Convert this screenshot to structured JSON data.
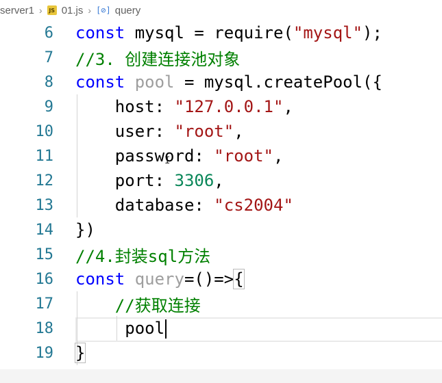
{
  "breadcrumb": {
    "folder": "server1",
    "file": "01.js",
    "file_icon": "js-file-icon",
    "symbol": "query",
    "symbol_icon": "variable-symbol-icon"
  },
  "editor": {
    "lines": [
      {
        "n": "6",
        "tokens": [
          [
            "kw",
            "const"
          ],
          [
            "code",
            " mysql = require("
          ],
          [
            "str",
            "\"mysql\""
          ],
          [
            "code",
            ");"
          ]
        ]
      },
      {
        "n": "7",
        "tokens": [
          [
            "cm",
            "//3. 创建连接池对象"
          ]
        ]
      },
      {
        "n": "8",
        "tokens": [
          [
            "kw",
            "const"
          ],
          [
            "code",
            " "
          ],
          [
            "faded",
            "pool"
          ],
          [
            "code",
            " = mysql.createPool({"
          ]
        ]
      },
      {
        "n": "9",
        "tokens": [
          [
            "code",
            "    host: "
          ],
          [
            "str",
            "\"127.0.0.1\""
          ],
          [
            "code",
            ","
          ]
        ]
      },
      {
        "n": "10",
        "tokens": [
          [
            "code",
            "    user: "
          ],
          [
            "str",
            "\"root\""
          ],
          [
            "code",
            ","
          ]
        ]
      },
      {
        "n": "11",
        "tokens": [
          [
            "code",
            "    password: "
          ],
          [
            "str",
            "\"root\""
          ],
          [
            "code",
            ","
          ]
        ]
      },
      {
        "n": "12",
        "tokens": [
          [
            "code",
            "    port: "
          ],
          [
            "num",
            "3306"
          ],
          [
            "code",
            ","
          ]
        ]
      },
      {
        "n": "13",
        "tokens": [
          [
            "code",
            "    database: "
          ],
          [
            "str",
            "\"cs2004\""
          ]
        ]
      },
      {
        "n": "14",
        "tokens": [
          [
            "code",
            "})"
          ]
        ]
      },
      {
        "n": "15",
        "tokens": [
          [
            "cm",
            "//4.封装sql方法"
          ]
        ]
      },
      {
        "n": "16",
        "tokens": [
          [
            "kw",
            "const"
          ],
          [
            "code",
            " "
          ],
          [
            "faded",
            "query"
          ],
          [
            "code",
            "=()=>"
          ],
          [
            "bracket",
            "{"
          ]
        ]
      },
      {
        "n": "17",
        "tokens": [
          [
            "cm",
            "    //获取连接"
          ]
        ]
      },
      {
        "n": "18",
        "tokens": [
          [
            "code",
            "     pool"
          ]
        ]
      },
      {
        "n": "19",
        "tokens": [
          [
            "bracket",
            "}"
          ]
        ]
      }
    ]
  },
  "colors": {
    "keyword": "#0000ff",
    "string": "#a31515",
    "number": "#098658",
    "comment": "#008000",
    "line_number": "#237893"
  }
}
